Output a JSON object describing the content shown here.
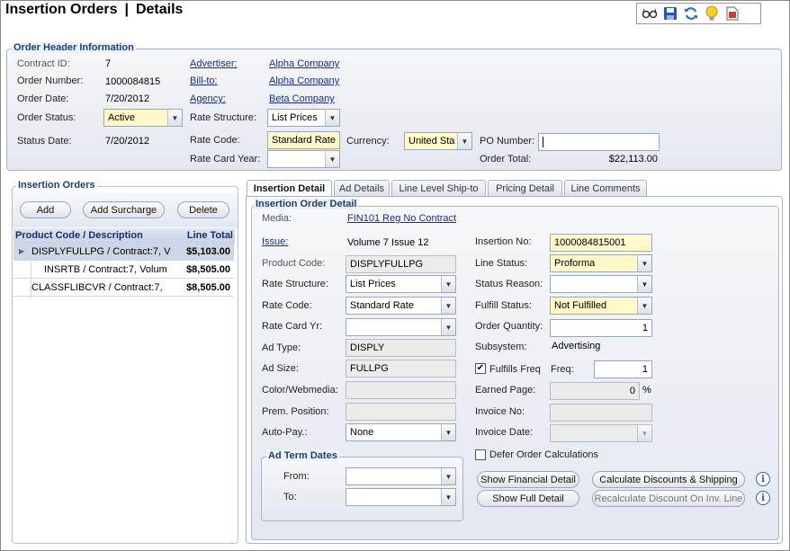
{
  "page": {
    "title_left": "Insertion Orders",
    "title_sep": "|",
    "title_right": "Details"
  },
  "toolbar": {
    "icons": [
      "glasses-icon",
      "save-icon",
      "refresh-icon",
      "lightbulb-icon",
      "report-icon"
    ]
  },
  "header": {
    "legend": "Order Header Information",
    "contract_id_label": "Contract ID:",
    "contract_id": "7",
    "order_number_label": "Order Number:",
    "order_number": "1000084815",
    "order_date_label": "Order Date:",
    "order_date": "7/20/2012",
    "order_status_label": "Order Status:",
    "order_status": "Active",
    "status_date_label": "Status Date:",
    "status_date": "7/20/2012",
    "advertiser_label": "Advertiser:",
    "advertiser": "Alpha Company",
    "billto_label": "Bill-to:",
    "billto": "Alpha Company",
    "agency_label": "Agency:",
    "agency": "Beta Company",
    "rate_structure_label": "Rate Structure:",
    "rate_structure": "List Prices",
    "rate_code_label": "Rate Code:",
    "rate_code": "Standard Rate",
    "rate_card_year_label": "Rate Card Year:",
    "rate_card_year": "",
    "currency_label": "Currency:",
    "currency": "United Sta",
    "po_label": "PO Number:",
    "po_number": "",
    "order_total_label": "Order Total:",
    "order_total": "$22,113.00"
  },
  "insertions": {
    "legend": "Insertion Orders",
    "add": "Add",
    "add_surcharge": "Add Surcharge",
    "delete": "Delete",
    "col_product": "Product Code / Description",
    "col_total": "Line Total",
    "rows": [
      {
        "product": "DISPLYFULLPG / Contract:7, V",
        "total": "$5,103.00"
      },
      {
        "product": "INSRTB / Contract:7, Volum",
        "total": "$8,505.00"
      },
      {
        "product": "CLASSFLIBCVR / Contract:7,",
        "total": "$8,505.00"
      }
    ]
  },
  "tabs": [
    "Insertion Detail",
    "Ad Details",
    "Line Level Ship-to",
    "Pricing Detail",
    "Line Comments"
  ],
  "detail": {
    "legend": "Insertion Order Detail",
    "media_label": "Media:",
    "media": "FIN101  Reg No Contract",
    "issue_label": "Issue:",
    "issue": "Volume 7 Issue 12",
    "product_code_label": "Product Code:",
    "product_code": "DISPLYFULLPG",
    "rate_structure_label": "Rate Structure:",
    "rate_structure": "List Prices",
    "rate_code_label": "Rate Code:",
    "rate_code": "Standard Rate",
    "rate_card_yr_label": "Rate Card Yr:",
    "rate_card_yr": "",
    "ad_type_label": "Ad Type:",
    "ad_type": "DISPLY",
    "ad_size_label": "Ad Size:",
    "ad_size": "FULLPG",
    "color_label": "Color/Webmedia:",
    "color": "",
    "prem_label": "Prem. Position:",
    "prem": "",
    "autopay_label": "Auto-Pay.:",
    "autopay": "None",
    "insertion_no_label": "Insertion No:",
    "insertion_no": "1000084815001",
    "line_status_label": "Line Status:",
    "line_status": "Proforma",
    "status_reason_label": "Status Reason:",
    "status_reason": "",
    "fulfill_status_label": "Fulfill Status:",
    "fulfill_status": "Not Fulfilled",
    "order_qty_label": "Order Quantity:",
    "order_qty": "1",
    "subsystem_label": "Subsystem:",
    "subsystem": "Advertising",
    "fulfills_freq_label": "Fulfills Freq",
    "freq_label": "Freq:",
    "freq": "1",
    "earned_page_label": "Earned Page:",
    "earned_page": "0",
    "earned_unit": "%",
    "invoice_no_label": "Invoice No:",
    "invoice_no": "",
    "invoice_date_label": "Invoice Date:",
    "invoice_date": "",
    "defer_label": "Defer Order Calculations",
    "ad_term_legend": "Ad Term Dates",
    "from_label": "From:",
    "to_label": "To:",
    "show_financial": "Show Financial Detail",
    "calc_discounts": "Calculate Discounts & Shipping",
    "show_full": "Show Full Detail",
    "recalc_discount": "Recalculate Discount On Inv. Line"
  }
}
